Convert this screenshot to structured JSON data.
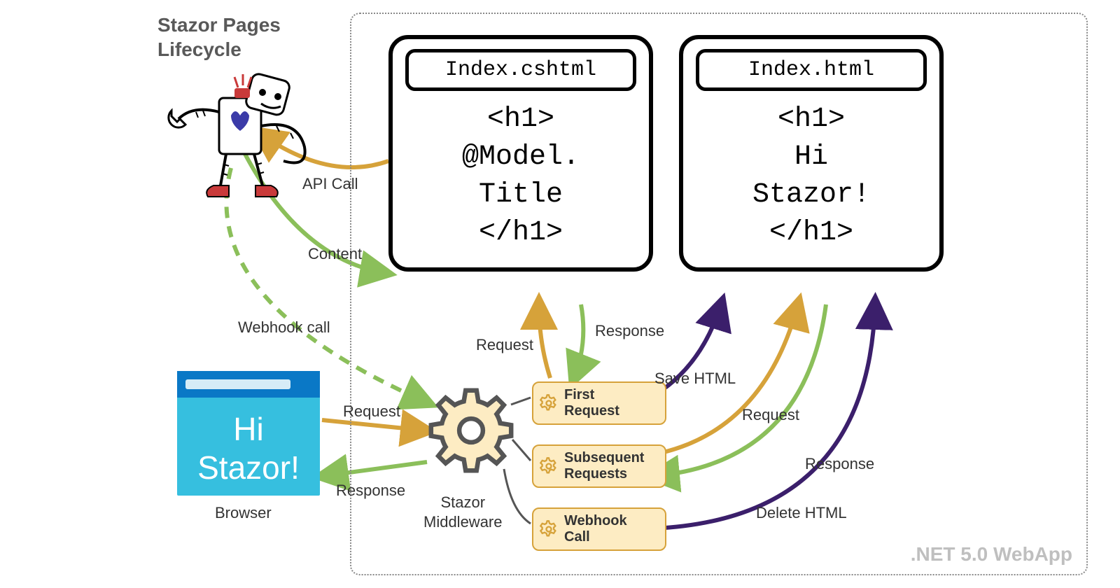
{
  "title_line1": "Stazor Pages",
  "title_line2": "Lifecycle",
  "container_label": ".NET 5.0 WebApp",
  "card_cshtml": {
    "filename": "Index.cshtml",
    "body": "<h1>\n@Model.\nTitle\n</h1>"
  },
  "card_html": {
    "filename": "Index.html",
    "body": "<h1>\nHi\nStazor!\n</h1>"
  },
  "browser_text": "Hi\nStazor!",
  "browser_label": "Browser",
  "mw_label": "Stazor\nMiddleware",
  "pills": {
    "first": "First\nRequest",
    "sub": "Subsequent\nRequests",
    "hook": "Webhook\nCall"
  },
  "arrow_labels": {
    "api_call": "API Call",
    "content": "Content",
    "webhook_call": "Webhook call",
    "request_browser": "Request",
    "response_browser": "Response",
    "request_cshtml": "Request",
    "response_cshtml": "Response",
    "save_html": "Save HTML",
    "request_html": "Request",
    "response_html": "Response",
    "delete_html": "Delete HTML"
  },
  "colors": {
    "orange": "#d6a23a",
    "green": "#8bbf5a",
    "purple": "#3b1f6b"
  }
}
